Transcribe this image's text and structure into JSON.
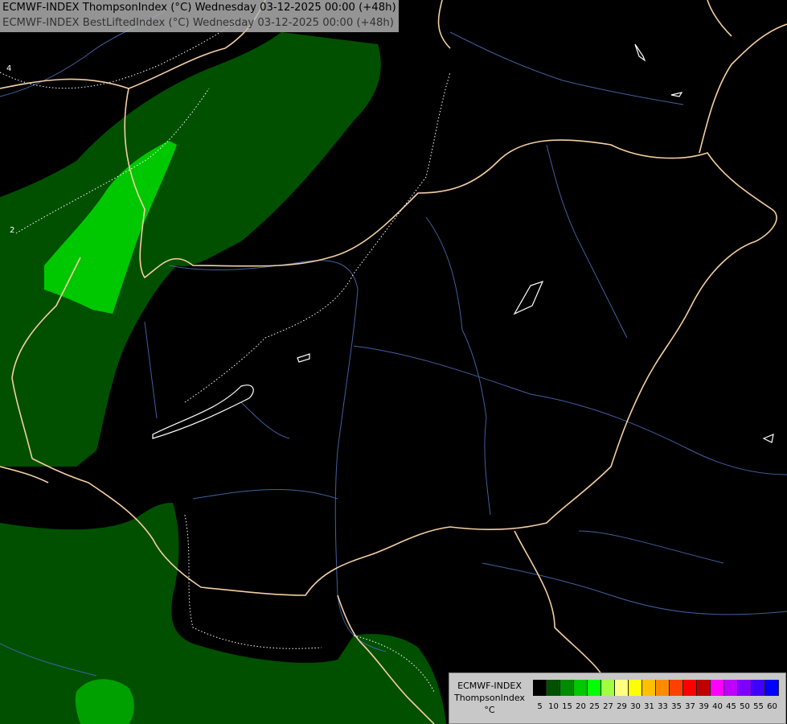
{
  "header": {
    "line1": "ECMWF-INDEX ThompsonIndex (°C) Wednesday 03-12-2025 00:00 (+48h)",
    "line2": "ECMWF-INDEX BestLiftedIndex (°C) Wednesday 03-12-2025 00:00 (+48h)"
  },
  "contour_labels": {
    "a": "4",
    "b": "2"
  },
  "legend": {
    "line1": "ECMWF-INDEX",
    "line2": "ThompsonIndex",
    "line3": "°C",
    "colors": [
      "#000000",
      "#000000",
      "#000000",
      "#000000",
      "#005000",
      "#008c00",
      "#00c800",
      "#00ff00",
      "#a0ff40",
      "#ffff80",
      "#ffff00",
      "#ffc000",
      "#ff8c00",
      "#ff4000",
      "#ff0000",
      "#c00000",
      "#ff00ff",
      "#c000ff",
      "#8000ff",
      "#4000ff",
      "#0000ff"
    ],
    "ticks": [
      "5",
      "10",
      "15",
      "20",
      "25",
      "27",
      "29",
      "30",
      "31",
      "33",
      "35",
      "37",
      "39",
      "40",
      "45",
      "50",
      "55",
      "60"
    ]
  },
  "colors": {
    "background": "#000000",
    "level_dark_green": "#005000",
    "level_mid_green": "#008c00",
    "level_bright_green": "#00c800",
    "borders": "#f5cfa0",
    "rivers": "#4060a0"
  }
}
